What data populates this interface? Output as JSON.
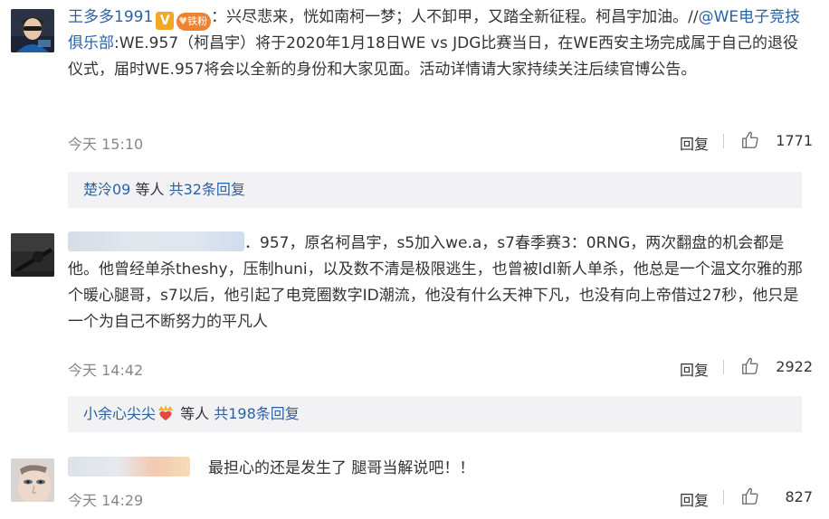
{
  "comments": [
    {
      "username": "王多多1991",
      "badge_v": "V",
      "badge_fan": "铁粉",
      "text_before_link": "：兴尽悲来，恍如南柯一梦；人不卸甲，又踏全新征程。柯昌宇加油。//",
      "mention": "@WE电子竞技俱乐部",
      "text_after_link": ":WE.957（柯昌宇）将于2020年1月18日WE vs JDG比赛当日，在WE西安主场完成属于自己的退役仪式，届时WE.957将会以全新的身份和大家见面。活动详情请大家持续关注后续官博公告。",
      "time": "今天 15:10",
      "reply_label": "回复",
      "likes": "1771",
      "replies": {
        "names": "楚泠09",
        "mid": " 等人 ",
        "count": "共32条回复"
      }
    },
    {
      "text": "．957，原名柯昌宇，s5加入we.a，s7春季赛3：0RNG，两次翻盘的机会都是他。他曾经单杀theshy，压制huni，以及数不清是极限逃生，也曾被ldl新人单杀，他总是一个温文尔雅的那个暖心腿哥，s7以后，他引起了电竞圈数字ID潮流，他没有什么天神下凡，也没有向上帝借过27秒，他只是一个为自己不断努力的平凡人",
      "time": "今天 14:42",
      "reply_label": "回复",
      "likes": "2922",
      "replies": {
        "names": "小余心尖尖",
        "mid": " 等人 ",
        "count": "共198条回复"
      }
    },
    {
      "text": "最担心的还是发生了 腿哥当解说吧！！",
      "time": "今天 14:29",
      "reply_label": "回复",
      "likes": "827"
    }
  ],
  "colors": {
    "link": "#2a62a6",
    "reply_bg": "#f2f2f5",
    "badge_v": "#f3a825",
    "badge_fan": "#f08332"
  }
}
